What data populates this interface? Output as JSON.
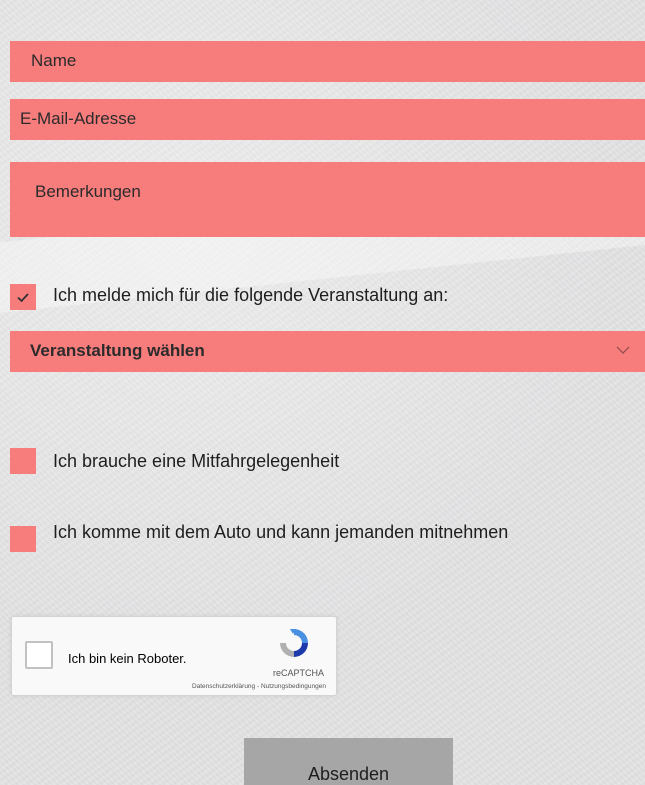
{
  "form": {
    "name_placeholder": "Name",
    "email_placeholder": "E-Mail-Adresse",
    "remarks_placeholder": "Bemerkungen",
    "event_checkbox": {
      "label": "Ich melde mich für die folgende Veranstaltung an:",
      "checked": true
    },
    "event_select": {
      "selected": "Veranstaltung wählen"
    },
    "ride_checkbox": {
      "label": "Ich brauche eine Mitfahrgelegenheit",
      "checked": false
    },
    "car_checkbox": {
      "label": "Ich komme mit dem Auto und kann jemanden mitnehmen",
      "checked": false
    },
    "submit_label": "Absenden"
  },
  "recaptcha": {
    "label": "Ich bin kein Roboter.",
    "brand": "reCAPTCHA",
    "links": "Datenschutzerklärung - Nutzungsbedingungen"
  },
  "colors": {
    "field_bg": "#f77c7c",
    "submit_bg": "#a6a6a6",
    "page_bg": "#e4e4e6"
  },
  "icons": {
    "check": "check-icon",
    "chevron": "chevron-down-icon",
    "recaptcha": "recaptcha-logo-icon"
  }
}
